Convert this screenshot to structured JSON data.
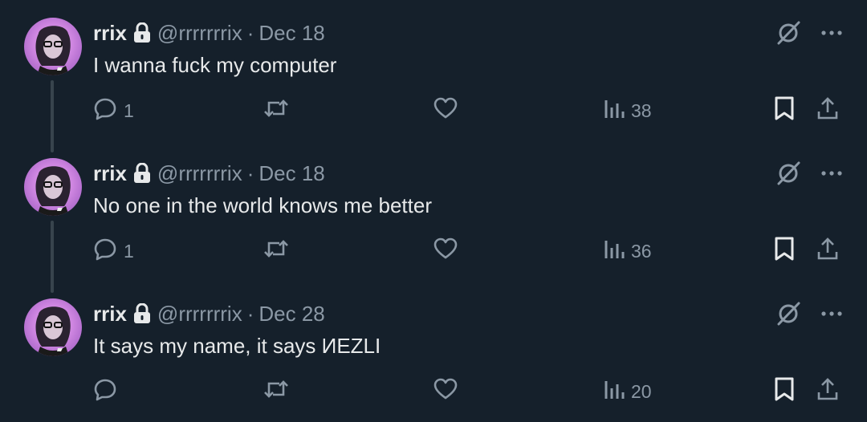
{
  "tweets": [
    {
      "name": "rrix",
      "handle": "@rrrrrrrix",
      "separator": "·",
      "date": "Dec 18",
      "text": "I wanna fuck my computer",
      "replies": "1",
      "views": "38"
    },
    {
      "name": "rrix",
      "handle": "@rrrrrrrix",
      "separator": "·",
      "date": "Dec 18",
      "text": "No one in the world knows me better",
      "replies": "1",
      "views": "36"
    },
    {
      "name": "rrix",
      "handle": "@rrrrrrrix",
      "separator": "·",
      "date": "Dec 28",
      "text": "It says my name, it says ИEZLI",
      "replies": "",
      "views": "20"
    }
  ],
  "colors": {
    "background": "#15202b",
    "text": "#e7e9ea",
    "muted": "#8b98a5",
    "thread_line": "#38444d"
  },
  "icons": [
    "lock-icon",
    "grok-icon",
    "more-icon",
    "reply-icon",
    "retweet-icon",
    "like-icon",
    "views-icon",
    "bookmark-icon",
    "share-icon"
  ]
}
